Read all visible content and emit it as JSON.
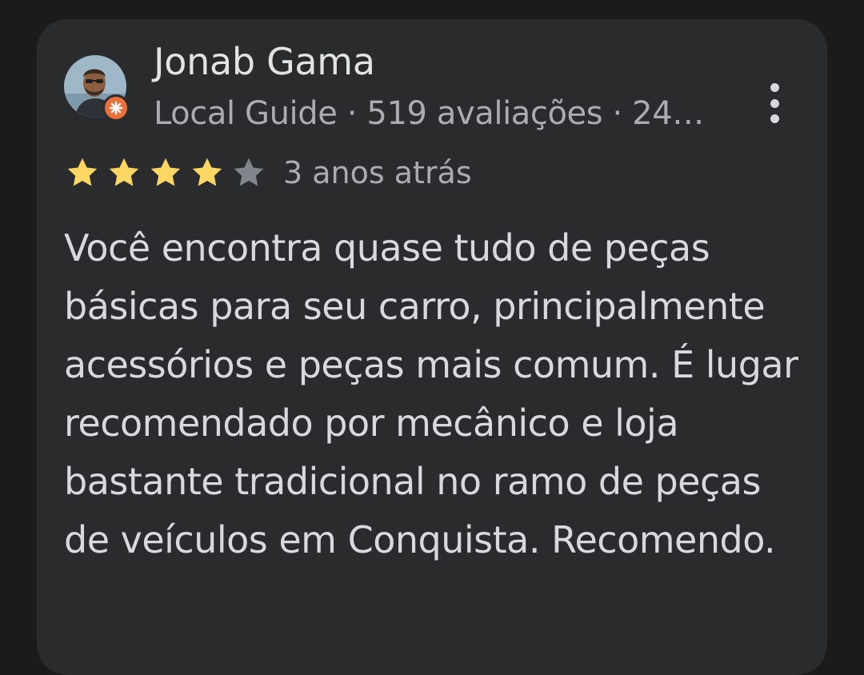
{
  "review": {
    "author": "Jonab Gama",
    "author_meta": "Local Guide · 519 avaliações · 24…",
    "rating": 4,
    "rating_max": 5,
    "time_ago": "3 anos atrás",
    "text": "Você encontra quase tudo de peças básicas para seu carro, principalmente acessórios e peças mais comum. É lugar recomendado por mecânico e loja bastante tradicional no ramo de peças de veículos em Conquista. Recomendo."
  },
  "icons": {
    "avatar": "user-avatar",
    "badge": "local-guide-badge-icon",
    "menu": "more-vert-icon",
    "star": "star-icon"
  },
  "colors": {
    "background": "#1b1b1c",
    "card": "#2a2b2d",
    "star_filled": "#fdd663",
    "star_empty": "#80868b",
    "badge": "#e8713c",
    "primary_text": "#e3e3e3",
    "secondary_text": "#a9acb0"
  }
}
